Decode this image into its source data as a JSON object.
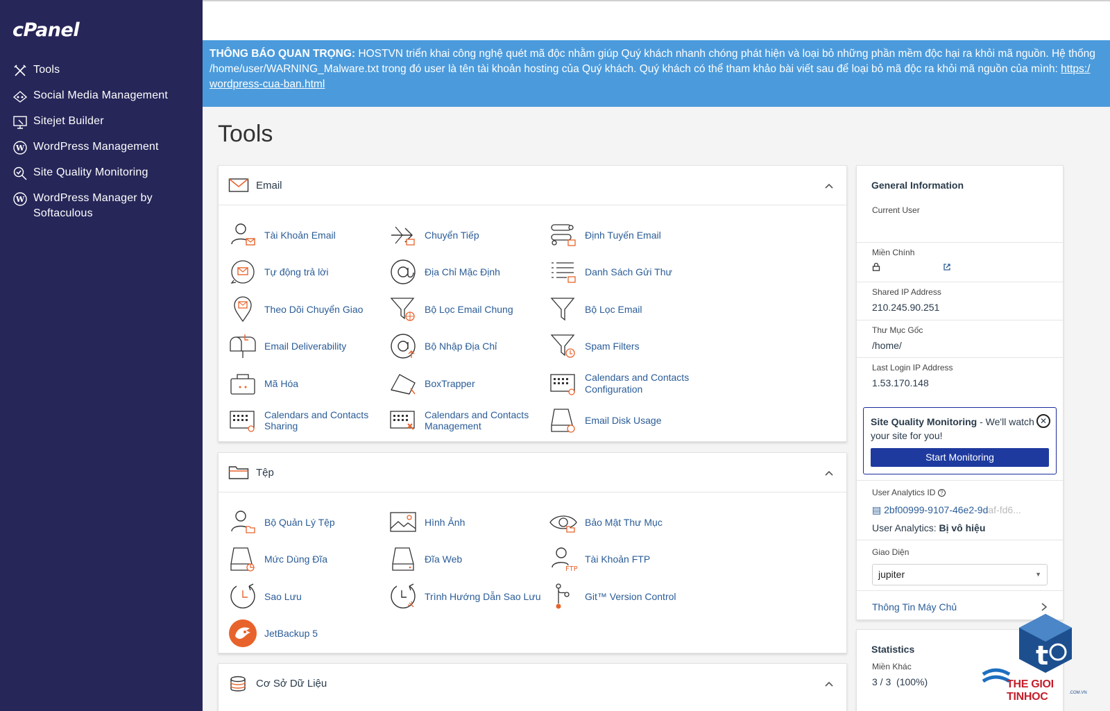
{
  "brand": "cPanel",
  "sidebar": {
    "items": [
      {
        "label": "Tools",
        "icon": "tools-icon"
      },
      {
        "label": "Social Media Management",
        "icon": "social-media-icon"
      },
      {
        "label": "Sitejet Builder",
        "icon": "sitejet-icon"
      },
      {
        "label": "WordPress Management",
        "icon": "wordpress-icon"
      },
      {
        "label": "Site Quality Monitoring",
        "icon": "site-quality-icon"
      },
      {
        "label": "WordPress Manager by Softaculous",
        "icon": "wordpress-icon"
      }
    ]
  },
  "notice": {
    "bold": "THÔNG BÁO QUAN TRỌNG:",
    "line1": " HOSTVN triển khai công nghệ quét mã độc nhằm giúp Quý khách nhanh chóng phát hiện và loại bỏ những phần mềm độc hại ra khỏi mã nguồn. Hệ thống",
    "line2": "/home/user/WARNING_Malware.txt trong đó user là tên tài khoản hosting của Quý khách. Quý khách có thể tham khảo bài viết sau để loại bỏ mã độc ra khỏi mã nguồn của mình: ",
    "link_head": "https:/",
    "link_tail": "wordpress-cua-ban.html"
  },
  "page_title": "Tools",
  "email": {
    "title": "Email",
    "tools": [
      {
        "label": "Tài Khoản Email",
        "icon": "email-accounts-icon"
      },
      {
        "label": "Chuyển Tiếp",
        "icon": "forwarders-icon"
      },
      {
        "label": "Định Tuyến Email",
        "icon": "email-routing-icon"
      },
      {
        "label": "Tự động trả lời",
        "icon": "autoresponders-icon"
      },
      {
        "label": "Địa Chỉ Mặc Định",
        "icon": "default-address-icon"
      },
      {
        "label": "Danh Sách Gửi Thư",
        "icon": "mailing-lists-icon"
      },
      {
        "label": "Theo Dõi Chuyển Giao",
        "icon": "track-delivery-icon"
      },
      {
        "label": "Bộ Lọc Email Chung",
        "icon": "global-email-filters-icon"
      },
      {
        "label": "Bộ Lọc Email",
        "icon": "email-filters-icon"
      },
      {
        "label": "Email Deliverability",
        "icon": "email-deliverability-icon"
      },
      {
        "label": "Bộ Nhập Địa Chỉ",
        "icon": "address-importer-icon"
      },
      {
        "label": "Spam Filters",
        "icon": "spam-filters-icon"
      },
      {
        "label": "Mã Hóa",
        "icon": "encryption-icon"
      },
      {
        "label": "BoxTrapper",
        "icon": "boxtrapper-icon"
      },
      {
        "label": "Calendars and Contacts Configuration",
        "icon": "calendar-config-icon"
      },
      {
        "label": "Calendars and Contacts Sharing",
        "icon": "calendar-sharing-icon"
      },
      {
        "label": "Calendars and Contacts Management",
        "icon": "calendar-management-icon"
      },
      {
        "label": "Email Disk Usage",
        "icon": "email-disk-usage-icon"
      }
    ]
  },
  "files": {
    "title": "Tệp",
    "tools": [
      {
        "label": "Bộ Quản Lý Tệp",
        "icon": "file-manager-icon"
      },
      {
        "label": "Hình Ảnh",
        "icon": "images-icon"
      },
      {
        "label": "Bảo Mật Thư Mục",
        "icon": "directory-privacy-icon"
      },
      {
        "label": "Mức Dùng Đĩa",
        "icon": "disk-usage-icon"
      },
      {
        "label": "Đĩa Web",
        "icon": "web-disk-icon"
      },
      {
        "label": "Tài Khoản FTP",
        "icon": "ftp-accounts-icon"
      },
      {
        "label": "Sao Lưu",
        "icon": "backup-icon"
      },
      {
        "label": "Trình Hướng Dẫn Sao Lưu",
        "icon": "backup-wizard-icon"
      },
      {
        "label": "Git™ Version Control",
        "icon": "git-icon"
      },
      {
        "label": "JetBackup 5",
        "icon": "jetbackup-icon"
      }
    ]
  },
  "database": {
    "title": "Cơ Sở Dữ Liệu"
  },
  "general": {
    "title": "General Information",
    "current_user_label": "Current User",
    "current_user_value": "",
    "primary_domain_label": "Miền Chính",
    "primary_domain_value": "",
    "shared_ip_label": "Shared IP Address",
    "shared_ip_value": "210.245.90.251",
    "home_dir_label": "Thư Mục Gốc",
    "home_dir_value": "/home/",
    "last_login_label": "Last Login IP Address",
    "last_login_value": "1.53.170.148",
    "sqm_bold": "Site Quality Monitoring",
    "sqm_text": " - We'll watch your site for you!",
    "sqm_button": "Start Monitoring",
    "analytics_label": "User Analytics ID",
    "analytics_id": "2bf00999-9107-46e2-9d",
    "analytics_id_faded": "af-fd6...",
    "analytics_status_label": "User Analytics: ",
    "analytics_status_value": "Bị vô hiệu",
    "theme_label": "Giao Diện",
    "theme_value": "jupiter",
    "server_info": "Thông Tin Máy Chủ"
  },
  "statistics": {
    "title": "Statistics",
    "addon_label": "Miền Khác",
    "addon_value": "3 / 3",
    "addon_percent": "(100%)"
  },
  "watermark": {
    "text": "THE GIOI TINHOC",
    "sub": ".COM.VN"
  },
  "colors": {
    "sidebar": "#262659",
    "notice": "#4b9bdc",
    "accent": "#1e3a9f",
    "orange": "#e8632b"
  }
}
